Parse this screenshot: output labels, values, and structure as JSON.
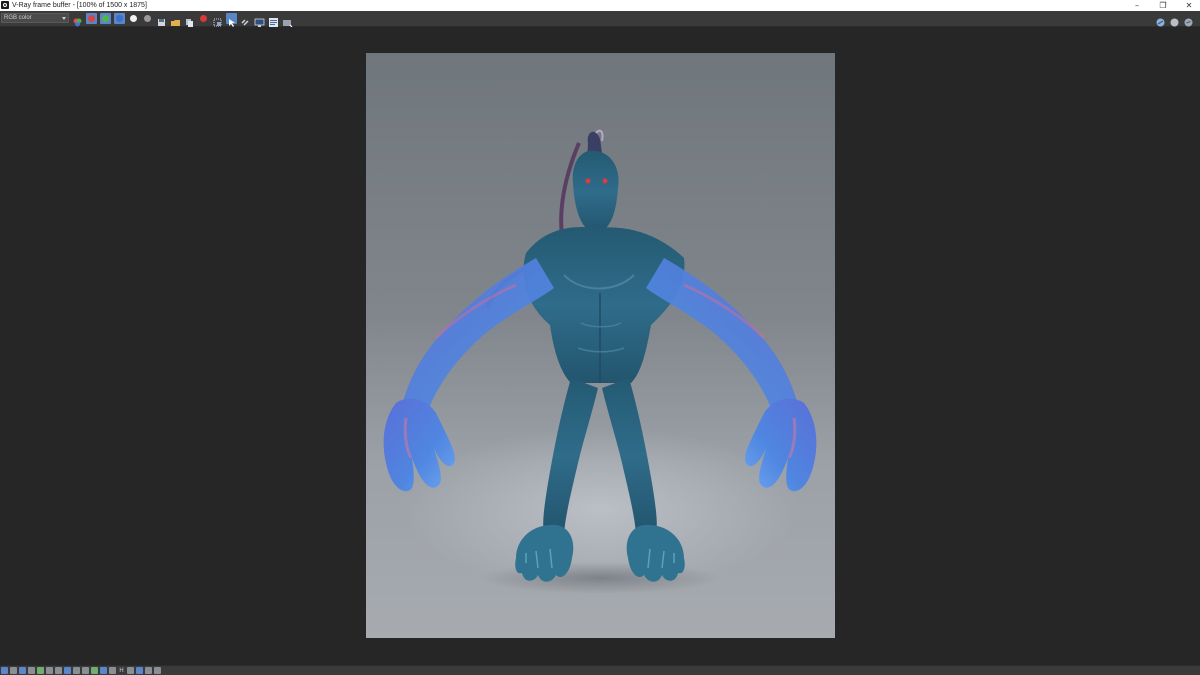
{
  "window": {
    "title": "V-Ray frame buffer - [100% of 1500 x 1875]",
    "minimize_glyph": "–",
    "restore_glyph": "❐",
    "close_glyph": "✕"
  },
  "toolbar": {
    "channel_value": "RGB color",
    "icons": [
      "color-channels-icon",
      "red-channel-icon",
      "green-channel-icon",
      "blue-channel-icon",
      "white-circle-icon",
      "alpha-icon",
      "save-icon",
      "open-icon",
      "copy-icon",
      "clear-icon",
      "region-render-icon",
      "track-mouse-icon",
      "link-icon",
      "display-icon",
      "history-icon",
      "lens-effects-icon"
    ],
    "right_icons": [
      "render-icon",
      "stop-icon",
      "settings-icon"
    ]
  },
  "statusbar": {
    "h_label": "H",
    "icons_count": 18
  },
  "colors": {
    "background": "#262626",
    "toolbar": "#3a3a3a",
    "accent": "#5a86c6",
    "creature": "#2f6c8a"
  }
}
